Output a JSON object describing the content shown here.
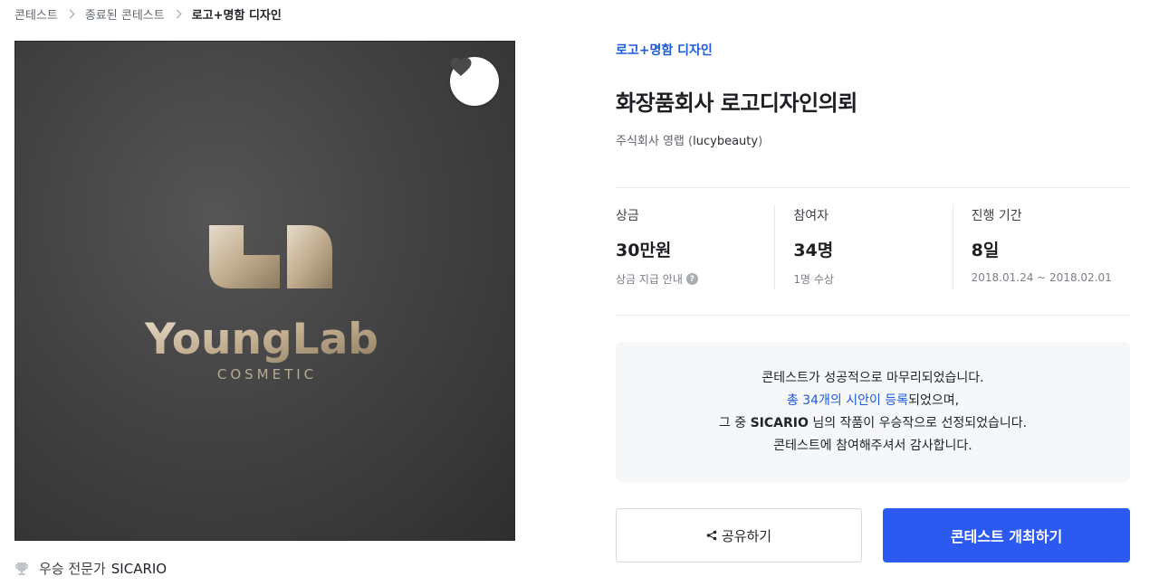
{
  "breadcrumb": {
    "items": [
      "콘테스트",
      "종료된 콘테스트",
      "로고+명함 디자인"
    ]
  },
  "hero": {
    "logo_wordmark": "YoungLab",
    "logo_tagline": "COSMETIC",
    "like_icon": "heart-icon"
  },
  "winner": {
    "icon": "trophy-icon",
    "label": "우승 전문가",
    "name": "SICARIO"
  },
  "contest": {
    "category": "로고+명함 디자인",
    "title": "화장품회사 로고디자인의뢰",
    "company": "주식회사 영랩",
    "handle_open": " (",
    "handle": "lucybeauty",
    "handle_close": ")"
  },
  "stats": [
    {
      "label": "상금",
      "value": "30만원",
      "sub": "상금 지급 안내",
      "sub_icon": "help-icon"
    },
    {
      "label": "참여자",
      "value": "34명",
      "sub": "1명 수상"
    },
    {
      "label": "진행 기간",
      "value": "8일",
      "sub": "2018.01.24 ~ 2018.02.01"
    }
  ],
  "notice": {
    "line1": "콘테스트가 성공적으로 마무리되었습니다.",
    "line2_link": "총 34개의 시안이 등록",
    "line2_rest": "되었으며,",
    "line3_pre": "그 중 ",
    "line3_name": "SICARIO",
    "line3_post": " 님의 작품이 우승작으로 선정되었습니다.",
    "line4": "콘테스트에 참여해주셔서 감사합니다."
  },
  "actions": {
    "share_label": "공유하기",
    "share_icon": "share-icon",
    "host_label": "콘테스트 개최하기"
  },
  "colors": {
    "accent": "#2c59f0",
    "link": "#1e5bd8",
    "notice_bg": "#f6f7f9",
    "logo_gold": "#cbb79a"
  }
}
